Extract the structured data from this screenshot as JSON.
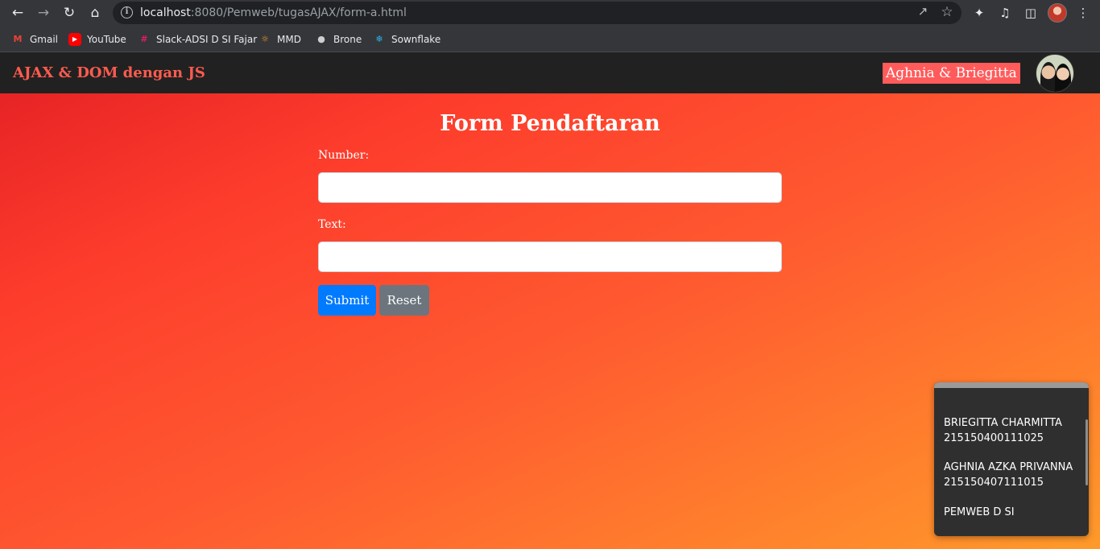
{
  "browser": {
    "url_host": "localhost",
    "url_rest": ":8080/Pemweb/tugasAJAX/form-a.html",
    "bookmarks": [
      "Gmail",
      "YouTube",
      "Slack-ADSI D SI Fajar",
      "MMD",
      "Brone",
      "Sownflake"
    ]
  },
  "navbar": {
    "brand": "AJAX & DOM dengan JS",
    "names": "Aghnia & Briegitta"
  },
  "form": {
    "title": "Form Pendaftaran",
    "number_label": "Number:",
    "number_value": "",
    "text_label": "Text:",
    "text_value": "",
    "submit_label": "Submit",
    "reset_label": "Reset"
  },
  "info_box": {
    "lines": [
      "BRIEGITTA CHARMITTA",
      "215150400111025",
      "AGHNIA AZKA PRIVANNA",
      "215150407111015",
      "PEMWEB D SI"
    ]
  },
  "colors": {
    "brand": "#ff5b4f",
    "names_bg": "#ff5b5b",
    "submit": "#007bff",
    "reset": "#6c757d",
    "navbar": "#212121"
  }
}
